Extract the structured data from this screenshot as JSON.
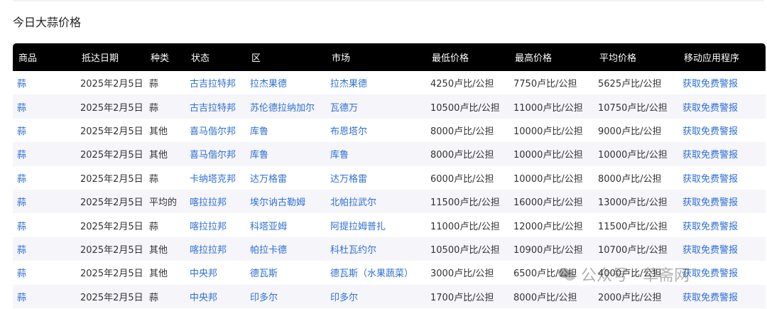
{
  "page": {
    "title": "今日大蒜价格"
  },
  "table": {
    "columns": [
      "商品",
      "抵达日期",
      "种类",
      "状态",
      "区",
      "市场",
      "最低价格",
      "最高价格",
      "平均价格",
      "移动应用程序"
    ],
    "rows": [
      [
        "蒜",
        "2025年2月5日",
        "蒜",
        "古吉拉特邦",
        "拉杰果德",
        "拉杰果德",
        "4250卢比/公担",
        "7750卢比/公担",
        "5625卢比/公担",
        "获取免费警报"
      ],
      [
        "蒜",
        "2025年2月5日",
        "蒜",
        "古吉拉特邦",
        "苏伦德拉纳加尔",
        "瓦德万",
        "10500卢比/公担",
        "11000卢比/公担",
        "10750卢比/公担",
        "获取免费警报"
      ],
      [
        "蒜",
        "2025年2月5日",
        "其他",
        "喜马偕尔邦",
        "库鲁",
        "布恩塔尔",
        "8000卢比/公担",
        "10000卢比/公担",
        "9000卢比/公担",
        "获取免费警报"
      ],
      [
        "蒜",
        "2025年2月5日",
        "其他",
        "喜马偕尔邦",
        "库鲁",
        "库鲁",
        "8000卢比/公担",
        "10000卢比/公担",
        "10000卢比/公担",
        "获取免费警报"
      ],
      [
        "蒜",
        "2025年2月5日",
        "蒜",
        "卡纳塔克邦",
        "达万格雷",
        "达万格雷",
        "6000卢比/公担",
        "10000卢比/公担",
        "8000卢比/公担",
        "获取免费警报"
      ],
      [
        "蒜",
        "2025年2月5日",
        "平均的",
        "喀拉拉邦",
        "埃尔讷古勒姆",
        "北帕拉武尔",
        "11500卢比/公担",
        "16000卢比/公担",
        "13000卢比/公担",
        "获取免费警报"
      ],
      [
        "蒜",
        "2025年2月5日",
        "蒜",
        "喀拉拉邦",
        "科塔亚姆",
        "阿提拉姆普扎",
        "11000卢比/公担",
        "12000卢比/公担",
        "11500卢比/公担",
        "获取免费警报"
      ],
      [
        "蒜",
        "2025年2月5日",
        "其他",
        "喀拉拉邦",
        "帕拉卡德",
        "科杜瓦约尔",
        "10500卢比/公担",
        "10900卢比/公担",
        "10700卢比/公担",
        "获取免费警报"
      ],
      [
        "蒜",
        "2025年2月5日",
        "其他",
        "中央邦",
        "德瓦斯",
        "德瓦斯（水果蔬菜）",
        "3000卢比/公担",
        "6500卢比/公担",
        "4000卢比/公担",
        "获取免费警报"
      ],
      [
        "蒜",
        "2025年2月5日",
        "蒜",
        "中央邦",
        "印多尔",
        "印多尔",
        "1700卢比/公担",
        "8000卢比/公担",
        "2000卢比/公担",
        "获取免费警报"
      ]
    ]
  },
  "watermark": {
    "text": "公众号 · 草斋网",
    "icon": "wechat-icon"
  },
  "colors": {
    "header_bg": "#000000",
    "link": "#2d6fd6",
    "stripe": "#f5f5fa"
  }
}
